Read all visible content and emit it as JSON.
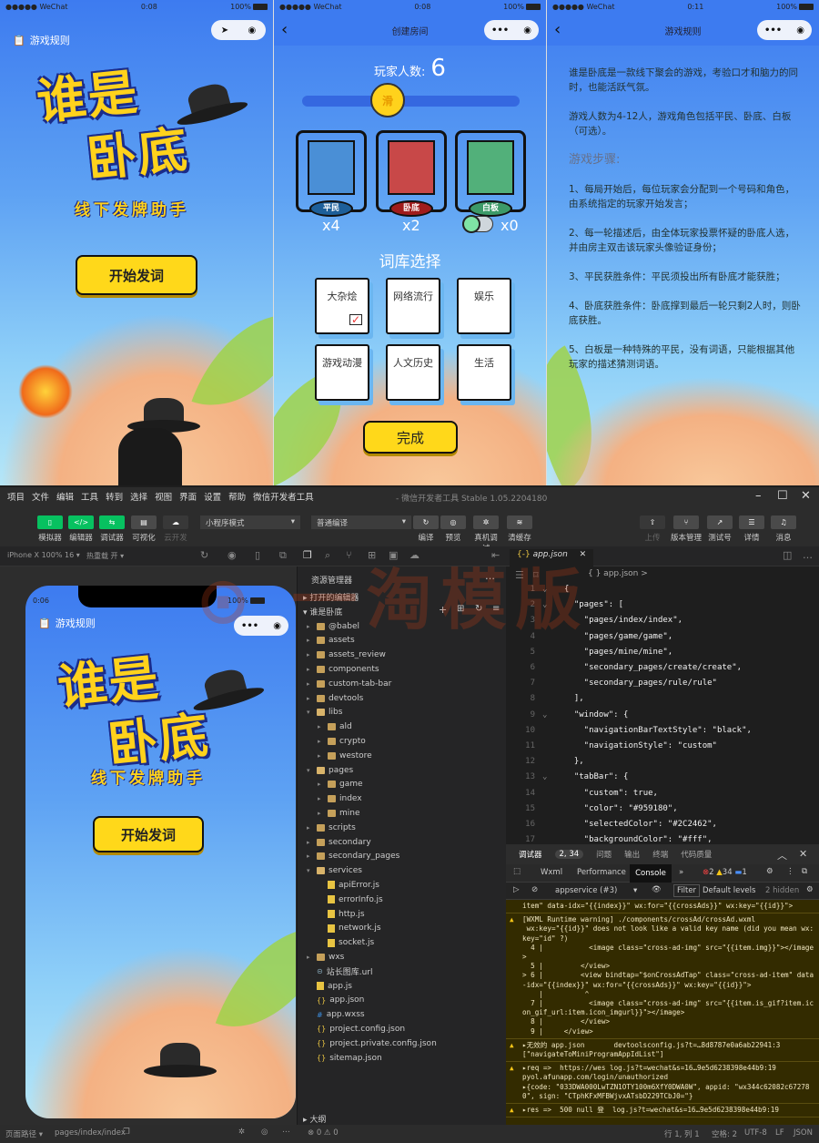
{
  "screens": {
    "home": {
      "status": {
        "carrier": "●●●●● WeChat",
        "time": "0:08",
        "battery": "100%"
      },
      "rules_link": "游戏规则",
      "logo_line1": "谁是",
      "logo_line2": "卧底",
      "subtitle": "线下发牌助手",
      "start_button": "开始发词"
    },
    "create": {
      "status": {
        "carrier": "●●●●● WeChat",
        "time": "0:08",
        "battery": "100%"
      },
      "title": "创建房间",
      "player_count_label": "玩家人数:",
      "player_count": "6",
      "slider_thumb": "滑",
      "slider_value": 6,
      "slider_range": [
        4,
        12
      ],
      "roles": [
        {
          "name": "平民",
          "count": "x4",
          "color": "#5aa8ea"
        },
        {
          "name": "卧底",
          "count": "x2",
          "color": "#ef6b6b"
        },
        {
          "name": "白板",
          "count": "x0",
          "color": "#7fe3a5",
          "toggle_on": false
        }
      ],
      "library_title": "词库选择",
      "libraries": [
        {
          "label": "大杂烩",
          "checked": true
        },
        {
          "label": "网络流行",
          "checked": false
        },
        {
          "label": "娱乐",
          "checked": false
        },
        {
          "label": "游戏动漫",
          "checked": false
        },
        {
          "label": "人文历史",
          "checked": false
        },
        {
          "label": "生活",
          "checked": false
        }
      ],
      "done_button": "完成"
    },
    "rules": {
      "status": {
        "carrier": "●●●●● WeChat",
        "time": "0:11",
        "battery": "100%"
      },
      "title": "游戏规则",
      "intro": "谁是卧底是一款线下聚会的游戏，考验口才和脑力的同时，也能活跃气氛。",
      "players": "游戏人数为4-12人，游戏角色包括平民、卧底、白板（可选）。",
      "steps_title": "游戏步骤:",
      "steps": [
        "1、每局开始后，每位玩家会分配到一个号码和角色，由系统指定的玩家开始发言；",
        "2、每一轮描述后，由全体玩家投票怀疑的卧底人选，并由房主双击该玩家头像验证身份；",
        "3、平民获胜条件：平民须投出所有卧底才能获胜；",
        "4、卧底获胜条件：卧底撑到最后一轮只剩2人时，则卧底获胜。",
        "5、白板是一种特殊的平民，没有词语，只能根据其他玩家的描述猜测词语。"
      ]
    }
  },
  "devtools": {
    "menu": [
      "项目",
      "文件",
      "编辑",
      "工具",
      "转到",
      "选择",
      "视图",
      "界面",
      "设置",
      "帮助",
      "微信开发者工具"
    ],
    "window_title": "- 微信开发者工具 Stable 1.05.2204180",
    "toolbar_left": [
      {
        "label": "模拟器",
        "icon": "phone-icon"
      },
      {
        "label": "编辑器",
        "icon": "code-icon"
      },
      {
        "label": "调试器",
        "icon": "debug-arrows-icon"
      },
      {
        "label": "可视化",
        "icon": "layout-icon"
      },
      {
        "label": "云开发",
        "icon": "cloud-icon"
      }
    ],
    "mode_select": "小程序模式",
    "compile_select": "普通编译",
    "toolbar_mid": [
      "编译",
      "预览",
      "真机调试",
      "清缓存"
    ],
    "toolbar_right": [
      "上传",
      "版本管理",
      "测试号",
      "详情",
      "消息"
    ],
    "device": "iPhone X 100% 16 ▾",
    "hot_reload": "热重载 开 ▾",
    "editor_tab": "app.json",
    "breadcrumb": "{ } app.json >",
    "simulator": {
      "time": "0:06",
      "battery": "100%",
      "rules_link": "游戏规则",
      "logo_line1": "谁是",
      "logo_line2": "卧底",
      "subtitle": "线下发牌助手",
      "start_button": "开始发词"
    },
    "explorer": {
      "title": "资源管理器",
      "open_editors": "打开的编辑器",
      "project": "谁是卧底",
      "outline": "大纲",
      "items": [
        {
          "name": "@babel",
          "type": "folder",
          "depth": 1
        },
        {
          "name": "assets",
          "type": "folder",
          "depth": 1
        },
        {
          "name": "assets_review",
          "type": "folder",
          "depth": 1
        },
        {
          "name": "components",
          "type": "folder",
          "depth": 1
        },
        {
          "name": "custom-tab-bar",
          "type": "folder",
          "depth": 1
        },
        {
          "name": "devtools",
          "type": "folder",
          "depth": 1
        },
        {
          "name": "libs",
          "type": "folder-open",
          "depth": 1
        },
        {
          "name": "ald",
          "type": "folder",
          "depth": 2
        },
        {
          "name": "crypto",
          "type": "folder",
          "depth": 2
        },
        {
          "name": "westore",
          "type": "folder",
          "depth": 2
        },
        {
          "name": "pages",
          "type": "folder-open",
          "depth": 1
        },
        {
          "name": "game",
          "type": "folder",
          "depth": 2
        },
        {
          "name": "index",
          "type": "folder",
          "depth": 2
        },
        {
          "name": "mine",
          "type": "folder",
          "depth": 2
        },
        {
          "name": "scripts",
          "type": "folder",
          "depth": 1
        },
        {
          "name": "secondary",
          "type": "folder",
          "depth": 1
        },
        {
          "name": "secondary_pages",
          "type": "folder",
          "depth": 1
        },
        {
          "name": "services",
          "type": "folder-open",
          "depth": 1
        },
        {
          "name": "apiError.js",
          "type": "js",
          "depth": 2
        },
        {
          "name": "errorInfo.js",
          "type": "js",
          "depth": 2
        },
        {
          "name": "http.js",
          "type": "js",
          "depth": 2
        },
        {
          "name": "network.js",
          "type": "js",
          "depth": 2
        },
        {
          "name": "socket.js",
          "type": "js",
          "depth": 2
        },
        {
          "name": "wxs",
          "type": "folder",
          "depth": 1
        },
        {
          "name": "站长图库.url",
          "type": "link",
          "depth": 1
        },
        {
          "name": "app.js",
          "type": "js",
          "depth": 1
        },
        {
          "name": "app.json",
          "type": "json",
          "depth": 1
        },
        {
          "name": "app.wxss",
          "type": "css",
          "depth": 1
        },
        {
          "name": "project.config.json",
          "type": "json",
          "depth": 1
        },
        {
          "name": "project.private.config.json",
          "type": "json",
          "depth": 1
        },
        {
          "name": "sitemap.json",
          "type": "json",
          "depth": 1
        }
      ],
      "problems": "⊗ 0 ⚠ 0"
    },
    "code": [
      "{",
      "  \"pages\": [",
      "    \"pages/index/index\",",
      "    \"pages/game/game\",",
      "    \"pages/mine/mine\",",
      "    \"secondary_pages/create/create\",",
      "    \"secondary_pages/rule/rule\"",
      "  ],",
      "  \"window\": {",
      "    \"navigationBarTextStyle\": \"black\",",
      "    \"navigationStyle\": \"custom\"",
      "  },",
      "  \"tabBar\": {",
      "    \"custom\": true,",
      "    \"color\": \"#959180\",",
      "    \"selectedColor\": \"#2C2462\",",
      "    \"backgroundColor\": \"#fff\","
    ],
    "console": {
      "panel_tabs": [
        "调试器",
        "2, 34",
        "问题",
        "输出",
        "终端",
        "代码质量"
      ],
      "tabs": [
        "Wxml",
        "Performance",
        "Console",
        "»"
      ],
      "errors": "2",
      "warnings": "34",
      "infos": "1",
      "context": "appservice (#3)",
      "filter": "Filter",
      "levels": "Default levels",
      "hidden": "2 hidden",
      "entries": [
        {
          "text": "item\" data-idx=\"{{index}}\" wx:for=\"{{crossAds}}\" wx:key=\"{{id}}\">",
          "warn": false
        },
        {
          "text": "[WXML Runtime warning] ./components/crossAd/crossAd.wxml\n wx:key=\"{{id}}\" does not look like a valid key name (did you mean wx:key=\"id\" ?)\n  4 |           <image class=\"cross-ad-img\" src=\"{{item.img}}\"></image>\n  5 |         </view>\n> 6 |         <view bindtap=\"$onCrossAdTap\" class=\"cross-ad-item\" data-idx=\"{{index}}\" wx:for=\"{{crossAds}}\" wx:key=\"{{id}}\">\n    |          ^\n  7 |           <image class=\"cross-ad-img\" src=\"{{item.is_gif?item.icon_gif_url:item.icon_imgurl}}\"></image>\n  8 |         </view>\n  9 |     </view>",
          "warn": true
        },
        {
          "text": "▸无效的 app.json       devtoolsconfig.js?t=…8d8787e0a6ab22941:3\n[\"navigateToMiniProgramAppIdList\"]",
          "warn": true
        },
        {
          "text": "▸req =>  https://wes log.js?t=wechat&s=16…9e5d6238398e44b9:19\npyol.afunapp.com/login/unauthorized\n▸{code: \"033DWA000LwTZN1OTY100m6XfY0DWA0W\", appid: \"wx344c62082c672780\", sign: \"CTphKFxMFBWjvxATsbD229TCbJ0=\"}",
          "warn": true
        },
        {
          "text": "▸res =>  500 null 登  log.js?t=wechat&s=16…9e5d6238398e44b9:19",
          "warn": true
        }
      ]
    },
    "statusbar": {
      "page_path_label": "页面路径 ▾",
      "page_path": "pages/index/index",
      "position": "行 1, 列 1",
      "spaces": "空格: 2",
      "encoding": "UTF-8",
      "eol": "LF",
      "language": "JSON"
    },
    "watermark": "一淘模版"
  }
}
